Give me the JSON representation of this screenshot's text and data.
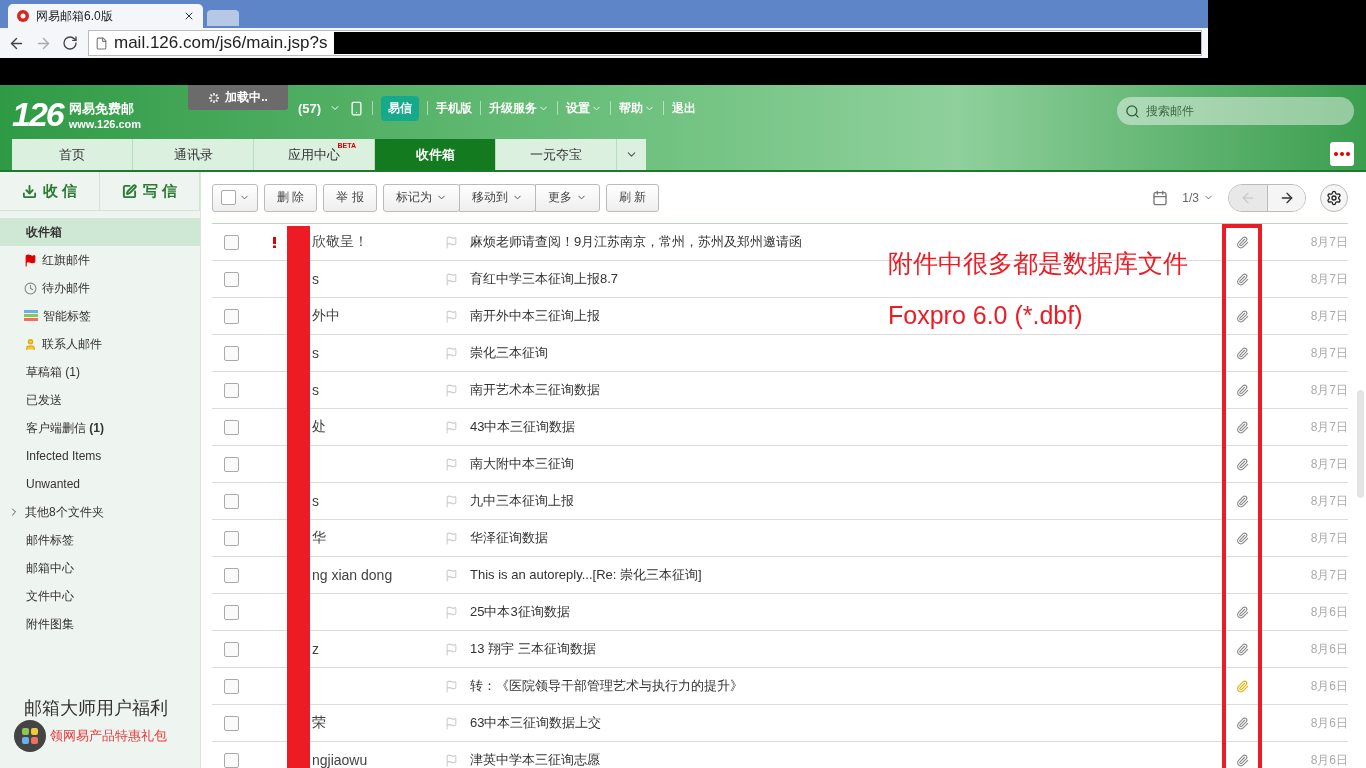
{
  "browser": {
    "tab_title": "网易邮箱6.0版",
    "url": "mail.126.com/js6/main.jsp?s"
  },
  "header": {
    "logo_number": "126",
    "logo_name": "网易免费邮",
    "logo_site": "www.126.com",
    "loading": "加载中..",
    "unread_count": "(57)",
    "yixin": "易信",
    "nav": [
      {
        "label": "手机版",
        "dropdown": false
      },
      {
        "label": "升级服务",
        "dropdown": true
      },
      {
        "label": "设置",
        "dropdown": true
      },
      {
        "label": "帮助",
        "dropdown": true
      },
      {
        "label": "退出",
        "dropdown": false
      }
    ],
    "search": {
      "placeholder": "搜索邮件"
    }
  },
  "tabs": [
    {
      "label": "首页",
      "selected": false
    },
    {
      "label": "通讯录",
      "selected": false
    },
    {
      "label": "应用中心",
      "badge": "BETA",
      "selected": false
    },
    {
      "label": "收件箱",
      "selected": true
    },
    {
      "label": "一元夺宝",
      "selected": false
    }
  ],
  "sidebar": {
    "receive": "收 信",
    "compose": "写 信",
    "folders": [
      {
        "label": "收件箱",
        "kind": "plain",
        "selected": true
      },
      {
        "label": "红旗邮件",
        "kind": "flagged",
        "selected": false
      },
      {
        "label": "待办邮件",
        "kind": "todo",
        "selected": false
      },
      {
        "label": "智能标签",
        "kind": "smart",
        "selected": false
      },
      {
        "label": "联系人邮件",
        "kind": "contacts",
        "selected": false
      },
      {
        "label": "草稿箱 (1)",
        "kind": "plain",
        "selected": false
      },
      {
        "label": "已发送",
        "kind": "plain",
        "selected": false
      },
      {
        "label": "客户端删信 **(1)**",
        "kind": "plain",
        "selected": false
      },
      {
        "label": "Infected Items",
        "kind": "plain",
        "selected": false
      },
      {
        "label": "Unwanted",
        "kind": "plain",
        "selected": false
      },
      {
        "label": "其他8个文件夹",
        "kind": "collapsed",
        "selected": false
      },
      {
        "label": "邮件标签",
        "kind": "plain",
        "selected": false
      },
      {
        "label": "邮箱中心",
        "kind": "plain",
        "selected": false
      },
      {
        "label": "文件中心",
        "kind": "plain",
        "selected": false
      },
      {
        "label": "附件图集",
        "kind": "plain",
        "selected": false
      }
    ],
    "promo": {
      "title": "邮箱大师用户福利",
      "subtitle": "领网易产品特惠礼包"
    }
  },
  "toolbar": {
    "buttons": [
      {
        "label": "删 除",
        "dropdown": false,
        "joined": false
      },
      {
        "label": "举 报",
        "dropdown": false,
        "joined": false
      },
      {
        "label": "标记为",
        "dropdown": true,
        "joined": false
      },
      {
        "label": "移动到",
        "dropdown": true,
        "joined": true
      },
      {
        "label": "更多",
        "dropdown": true,
        "joined": true
      },
      {
        "label": "刷 新",
        "dropdown": false,
        "joined": false
      }
    ],
    "page": "1/3"
  },
  "messages": [
    {
      "checked": false,
      "important": true,
      "sender": "欣敬呈！",
      "subject": "麻烦老师请查阅！9月江苏南京，常州，苏州及郑州邀请函",
      "attachment": true,
      "attachment_highlighted": false,
      "date": "8月7日"
    },
    {
      "checked": false,
      "important": false,
      "sender": "s",
      "subject": "育红中学三本征询上报8.7",
      "attachment": true,
      "attachment_highlighted": false,
      "date": "8月7日"
    },
    {
      "checked": false,
      "important": false,
      "sender": "外中",
      "subject": "南开外中本三征询上报",
      "attachment": true,
      "attachment_highlighted": false,
      "date": "8月7日"
    },
    {
      "checked": false,
      "important": false,
      "sender": "s",
      "subject": "崇化三本征询",
      "attachment": true,
      "attachment_highlighted": false,
      "date": "8月7日"
    },
    {
      "checked": false,
      "important": false,
      "sender": "s",
      "subject": "南开艺术本三征询数据",
      "attachment": true,
      "attachment_highlighted": false,
      "date": "8月7日"
    },
    {
      "checked": false,
      "important": false,
      "sender": "处",
      "subject": "43中本三征询数据",
      "attachment": true,
      "attachment_highlighted": false,
      "date": "8月7日"
    },
    {
      "checked": false,
      "important": false,
      "subject": "南大附中本三征询",
      "attachment": true,
      "attachment_highlighted": false,
      "date": "8月7日"
    },
    {
      "checked": false,
      "important": false,
      "sender": "s",
      "subject": "九中三本征询上报",
      "attachment": true,
      "attachment_highlighted": false,
      "date": "8月7日"
    },
    {
      "checked": false,
      "important": false,
      "sender": "华",
      "subject": "华泽征询数据",
      "attachment": true,
      "attachment_highlighted": false,
      "date": "8月7日"
    },
    {
      "checked": false,
      "important": false,
      "sender": "ng xian dong",
      "subject": "This is an autoreply...[Re: 崇化三本征询]",
      "attachment": false,
      "date": "8月7日"
    },
    {
      "checked": false,
      "important": false,
      "subject": "25中本3征询数据",
      "attachment": true,
      "attachment_highlighted": false,
      "date": "8月6日"
    },
    {
      "checked": false,
      "important": false,
      "sender": "z",
      "subject": "13 翔宇 三本征询数据",
      "attachment": true,
      "attachment_highlighted": false,
      "date": "8月6日"
    },
    {
      "checked": false,
      "important": false,
      "subject": "转：《医院领导干部管理艺术与执行力的提升》",
      "attachment": true,
      "attachment_highlighted": true,
      "date": "8月6日"
    },
    {
      "checked": false,
      "important": false,
      "sender": "荣",
      "subject": "63中本三征询数据上交",
      "attachment": true,
      "attachment_highlighted": false,
      "date": "8月6日"
    },
    {
      "checked": false,
      "important": false,
      "sender": "ngjiaowu",
      "subject": "津英中学本三征询志愿",
      "attachment": true,
      "attachment_highlighted": false,
      "date": "8月6日"
    }
  ],
  "annotations": [
    "附件中很多都是数据库文件",
    "Foxpro 6.0 (*.dbf)"
  ]
}
